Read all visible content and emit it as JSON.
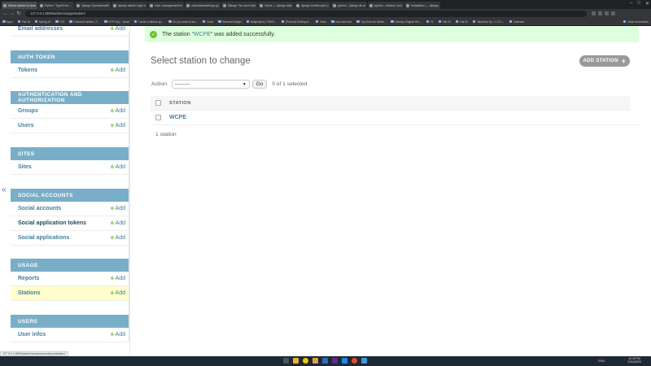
{
  "browser": {
    "tabs": [
      "Select station to chang...",
      "Python \"TypeError: ...\"",
      "Django OperationalErr...",
      "django allauth login wi...",
      "User management with...",
      "radiostats/settings.py a...",
      "Django \"No such table\"",
      "Views — django allauth",
      "django.contrib.auth | D...",
      "python - Django all auth",
      "python - relation \"acco...",
      "Installation — django-a..."
    ],
    "url": "127.0.0.1:8000/admin/usage/station/",
    "bookmarks": [
      "Apps",
      "Fall 18",
      "Spring 19",
      "F19",
      "Careers/Cambio | T...",
      "HTP FAQ - Israel",
      "I wrote a fitness ap...",
      "So you want to lea...",
      "Code",
      "SelectorGadget",
      "Scalproject | CSDN...",
      "[Tutorial] Getting st...",
      "Gach",
      "new.orbit.one",
      "Top Gear for Athlet...",
      "Divinity Original Sin...",
      "F4",
      "Fall 20",
      "Fall 20",
      "TakeZero Ep. 1-13 L...",
      "Calendar"
    ],
    "other_bookmarks": "Other bookmarks"
  },
  "sidebar": {
    "collapse_icon": "«",
    "modules": [
      {
        "header": "",
        "items": [
          {
            "label": "Email addresses",
            "add": "Add"
          }
        ]
      },
      {
        "header": "Auth Token",
        "items": [
          {
            "label": "Tokens",
            "add": "Add"
          }
        ]
      },
      {
        "header": "Authentication and Authorization",
        "items": [
          {
            "label": "Groups",
            "add": "Add"
          },
          {
            "label": "Users",
            "add": "Add"
          }
        ]
      },
      {
        "header": "Sites",
        "items": [
          {
            "label": "Sites",
            "add": "Add"
          }
        ]
      },
      {
        "header": "Social Accounts",
        "items": [
          {
            "label": "Social accounts",
            "add": "Add"
          },
          {
            "label": "Social application tokens",
            "add": "Add"
          },
          {
            "label": "Social applications",
            "add": "Add"
          }
        ]
      },
      {
        "header": "Usage",
        "items": [
          {
            "label": "Reports",
            "add": "Add"
          },
          {
            "label": "Stations",
            "add": "Add"
          }
        ]
      },
      {
        "header": "Users",
        "items": [
          {
            "label": "User infos",
            "add": "Add"
          }
        ]
      }
    ]
  },
  "message": {
    "prefix": "The station “",
    "link": "WCPE",
    "suffix": "” was added successfully."
  },
  "main": {
    "title": "Select station to change",
    "add_button": "ADD STATION",
    "action_label": "Action:",
    "action_selected": "---------",
    "go_label": "Go",
    "selection_count": "0 of 1 selected",
    "column_header": "STATION",
    "rows": [
      "WCPE"
    ],
    "paginator": "1 station"
  },
  "status_url": "127.0.0.1:8000/admin/socialaccount/socialtoken/",
  "taskbar": {
    "tray": "ENG",
    "time": "10:25 PM",
    "date": "12/16/2020"
  },
  "colors": {
    "module_header": "#79aec8",
    "link": "#447e9b",
    "success_bg": "#dfd",
    "highlight_row": "#ffffcc"
  }
}
